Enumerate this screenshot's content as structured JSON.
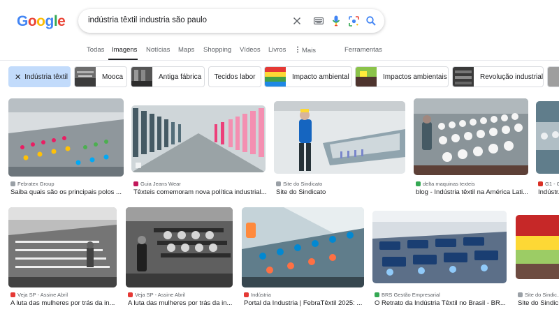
{
  "logo": {
    "letters": [
      "G",
      "o",
      "o",
      "g",
      "l",
      "e"
    ],
    "colors": [
      "#4285f4",
      "#ea4335",
      "#fbbc05",
      "#4285f4",
      "#34a853",
      "#ea4335"
    ]
  },
  "search": {
    "query": "indústria têxtil industria são paulo",
    "icons": {
      "clear": "close-icon",
      "keyboard": "keyboard-icon",
      "voice": "microphone-icon",
      "lens": "lens-icon",
      "search": "search-icon"
    }
  },
  "tabs": [
    {
      "label": "Todas",
      "active": false
    },
    {
      "label": "Imagens",
      "active": true
    },
    {
      "label": "Notícias",
      "active": false
    },
    {
      "label": "Maps",
      "active": false
    },
    {
      "label": "Shopping",
      "active": false
    },
    {
      "label": "Vídeos",
      "active": false
    },
    {
      "label": "Livros",
      "active": false
    },
    {
      "label": "Mais",
      "active": false
    },
    {
      "label": "Ferramentas",
      "active": false
    }
  ],
  "chips": [
    {
      "label": "Indústria têxtil",
      "selected": true
    },
    {
      "label": "Mooca"
    },
    {
      "label": "Antiga fábrica"
    },
    {
      "label": "Tecidos labor"
    },
    {
      "label": "Impacto ambiental"
    },
    {
      "label": "Impactos ambientais"
    },
    {
      "label": "Revolução industrial"
    }
  ],
  "results_row1": [
    {
      "source": "Febratex Group",
      "title": "Saiba quais são os principais polos ...",
      "fav_color": "#9aa0a6"
    },
    {
      "source": "Guia Jeans Wear",
      "title": "Têxteis comemoram nova política industrial...",
      "fav_color": "#c2185b"
    },
    {
      "source": "Site do Sindicato",
      "title": "Site do Sindicato",
      "fav_color": "#9aa0a6"
    },
    {
      "source": "delta maquinas texteis",
      "title": "blog - Indústria têxtil na América Lati...",
      "fav_color": "#34a853"
    },
    {
      "source": "G1 - G...",
      "title": "Indústr...",
      "fav_color": "#d93025"
    }
  ],
  "results_row2": [
    {
      "source": "Veja SP - Assine Abril",
      "title": "A luta das mulheres por trás da in...",
      "fav_color": "#e53935"
    },
    {
      "source": "Veja SP - Assine Abril",
      "title": "A luta das mulheres por trás da in...",
      "fav_color": "#e53935"
    },
    {
      "source": "Indústria",
      "title": "Portal da Industria | FebraTêxtil 2025: ...",
      "fav_color": "#e53935"
    },
    {
      "source": "BRS Gestão Empresarial",
      "title": "O Retrato da Indústria Têxtil no Brasil - BR...",
      "fav_color": "#34a853"
    },
    {
      "source": "Site do Sindic...",
      "title": "Site do Sindic...",
      "fav_color": "#9aa0a6"
    }
  ]
}
